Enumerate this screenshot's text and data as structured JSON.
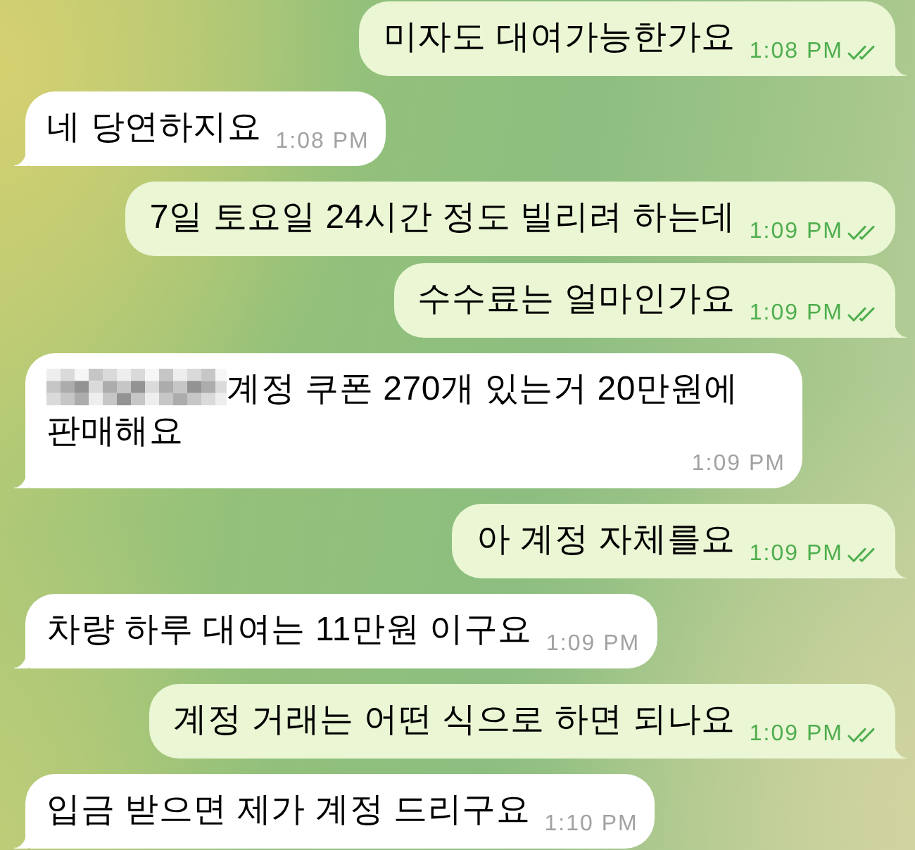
{
  "messages": [
    {
      "kind": "outgoing",
      "redacted": false,
      "text": "미자도 대여가능한가요",
      "time": "1:08 PM",
      "read": true
    },
    {
      "kind": "incoming",
      "redacted": false,
      "text": "네 당연하지요",
      "time": "1:08 PM"
    },
    {
      "kind": "outgoing",
      "redacted": false,
      "text": "7일 토요일 24시간 정도 빌리려 하는데",
      "time": "1:09 PM",
      "read": true
    },
    {
      "kind": "outgoing",
      "redacted": false,
      "text": "수수료는 얼마인가요",
      "time": "1:09 PM",
      "read": true
    },
    {
      "kind": "incoming",
      "redacted": true,
      "text": "계정 쿠폰 270개 있는거 20만원에 판매해요",
      "time": "1:09 PM"
    },
    {
      "kind": "outgoing",
      "redacted": false,
      "text": "아 계정 자체를요",
      "time": "1:09 PM",
      "read": true
    },
    {
      "kind": "incoming",
      "redacted": false,
      "text": "차량 하루 대여는 11만원 이구요",
      "time": "1:09 PM"
    },
    {
      "kind": "outgoing",
      "redacted": false,
      "text": "계정 거래는 어떤 식으로 하면 되나요",
      "time": "1:09 PM",
      "read": true
    },
    {
      "kind": "incoming",
      "redacted": false,
      "text": "입금 받으면 제가 계정 드리구요",
      "time": "1:10 PM"
    }
  ]
}
